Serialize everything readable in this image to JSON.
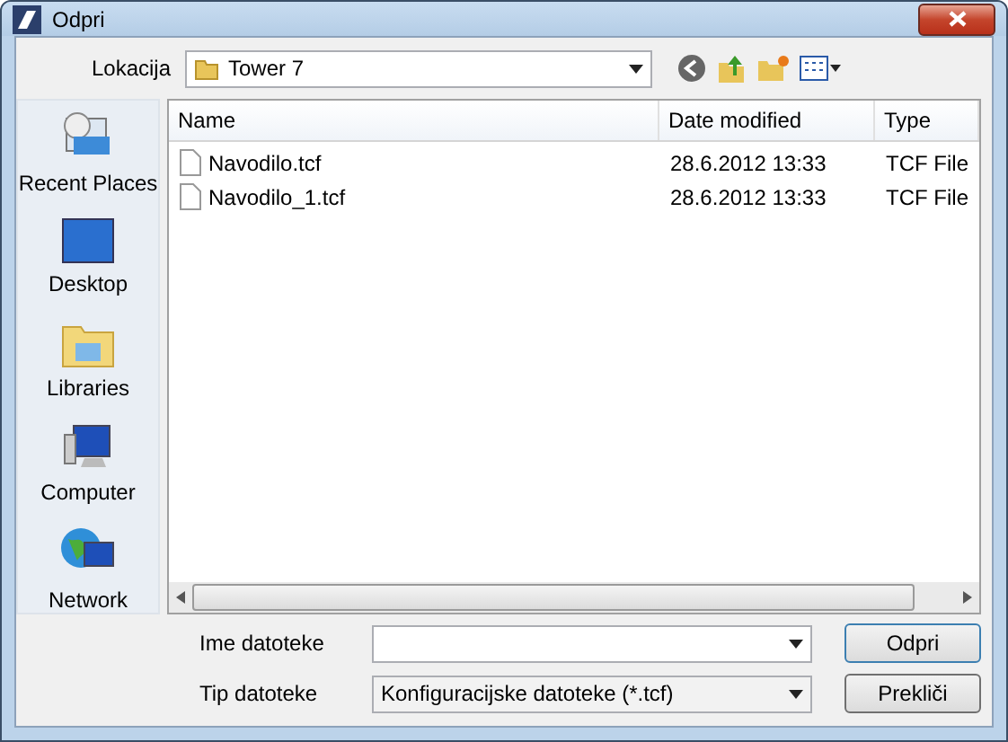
{
  "window": {
    "title": "Odpri"
  },
  "location": {
    "label": "Lokacija",
    "value": "Tower 7"
  },
  "sidebar": {
    "items": [
      {
        "label": "Recent Places",
        "kind": "recent"
      },
      {
        "label": "Desktop",
        "kind": "desktop"
      },
      {
        "label": "Libraries",
        "kind": "libraries"
      },
      {
        "label": "Computer",
        "kind": "computer"
      },
      {
        "label": "Network",
        "kind": "network"
      }
    ]
  },
  "table": {
    "columns": [
      "Name",
      "Date modified",
      "Type"
    ],
    "rows": [
      [
        "Navodilo.tcf",
        "28.6.2012 13:33",
        "TCF File"
      ],
      [
        "Navodilo_1.tcf",
        "28.6.2012 13:33",
        "TCF File"
      ]
    ]
  },
  "filename": {
    "label": "Ime datoteke"
  },
  "filetype": {
    "label": "Tip datoteke",
    "value": "Konfiguracijske datoteke (*.tcf)"
  },
  "buttons": [
    "Odpri",
    "Prekliči"
  ]
}
